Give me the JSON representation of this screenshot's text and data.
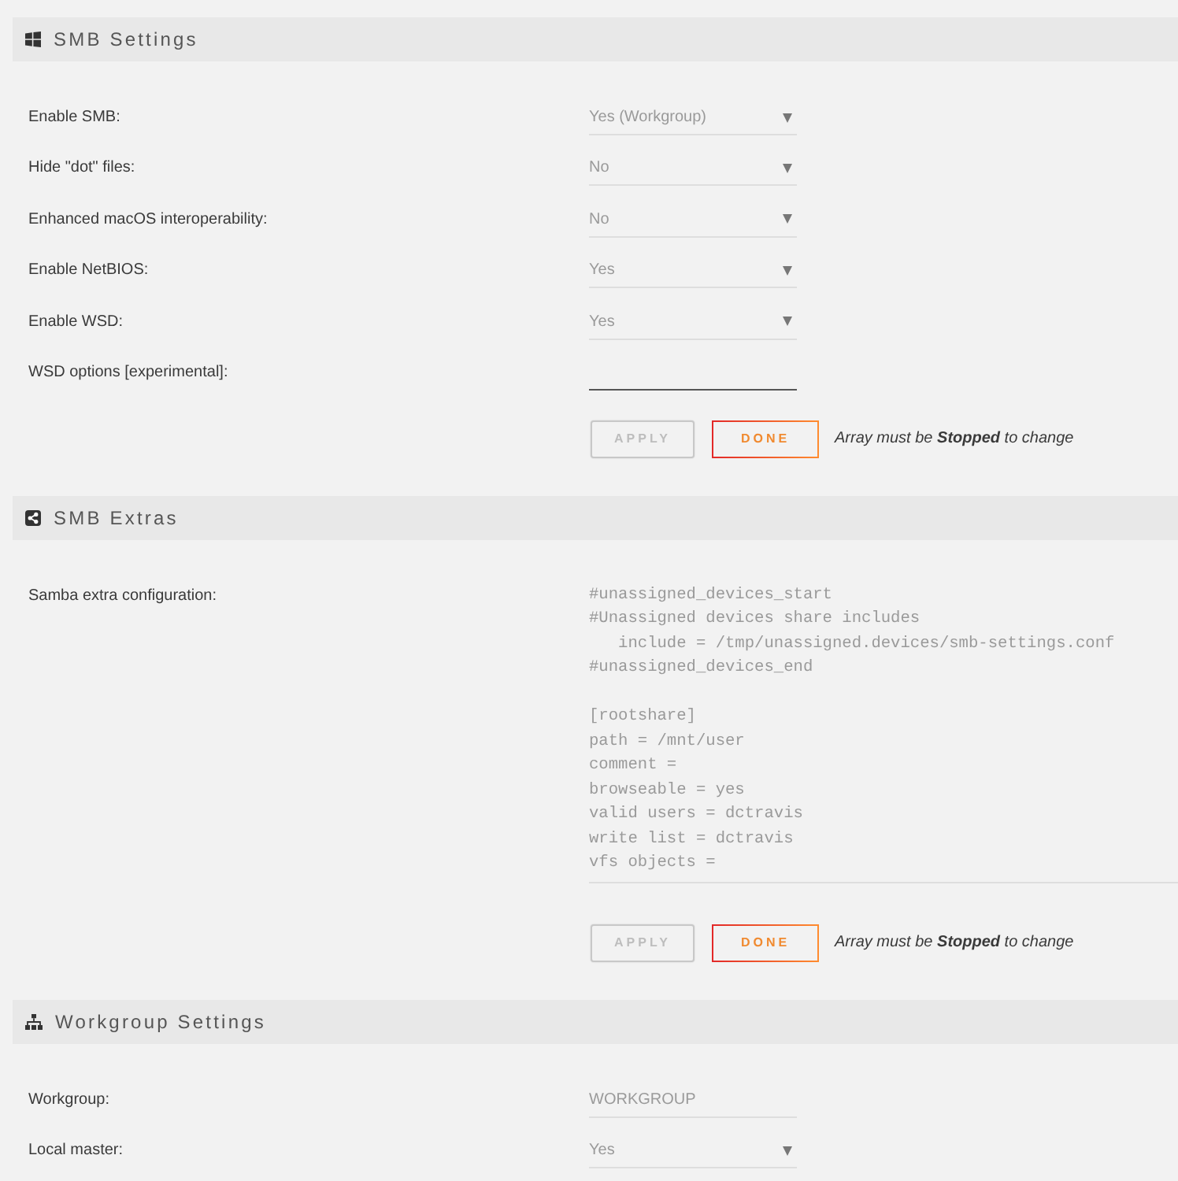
{
  "sections": [
    {
      "title": "SMB Settings",
      "rows": [
        {
          "kind": "select",
          "label": "Enable SMB:",
          "value": "Yes (Workgroup)"
        },
        {
          "kind": "select",
          "label": "Hide \"dot\" files:",
          "value": "No"
        },
        {
          "kind": "select",
          "label": "Enhanced macOS interoperability:",
          "value": "No"
        },
        {
          "kind": "select",
          "label": "Enable NetBIOS:",
          "value": "Yes"
        },
        {
          "kind": "select",
          "label": "Enable WSD:",
          "value": "Yes"
        },
        {
          "kind": "text",
          "label": "WSD options [experimental]:"
        }
      ],
      "actions": {
        "buttons": [
          {
            "label": "APPLY",
            "disabled": true
          },
          {
            "label": "DONE",
            "disabled": false
          }
        ],
        "note": "Array must be **Stopped** to change"
      }
    },
    {
      "title": "SMB Extras",
      "rows": [
        {
          "kind": "textarea",
          "label": "Samba extra configuration:",
          "value": "#unassigned_devices_start\n#Unassigned devices share includes\n   include = /tmp/unassigned.devices/smb-settings.conf\n#unassigned_devices_end\n\n[rootshare]\npath = /mnt/user\ncomment =\nbrowseable = yes\nvalid users = dctravis\nwrite list = dctravis\nvfs objects ="
        }
      ],
      "actions": {
        "buttons": [
          {
            "label": "APPLY",
            "disabled": true
          },
          {
            "label": "DONE",
            "disabled": false
          }
        ],
        "note": "Array must be **Stopped** to change"
      }
    },
    {
      "title": "Workgroup Settings",
      "rows": [
        {
          "kind": "text",
          "label": "Workgroup:",
          "value": "WORKGROUP"
        },
        {
          "kind": "select",
          "label": "Local master:",
          "value": "Yes"
        }
      ]
    }
  ]
}
